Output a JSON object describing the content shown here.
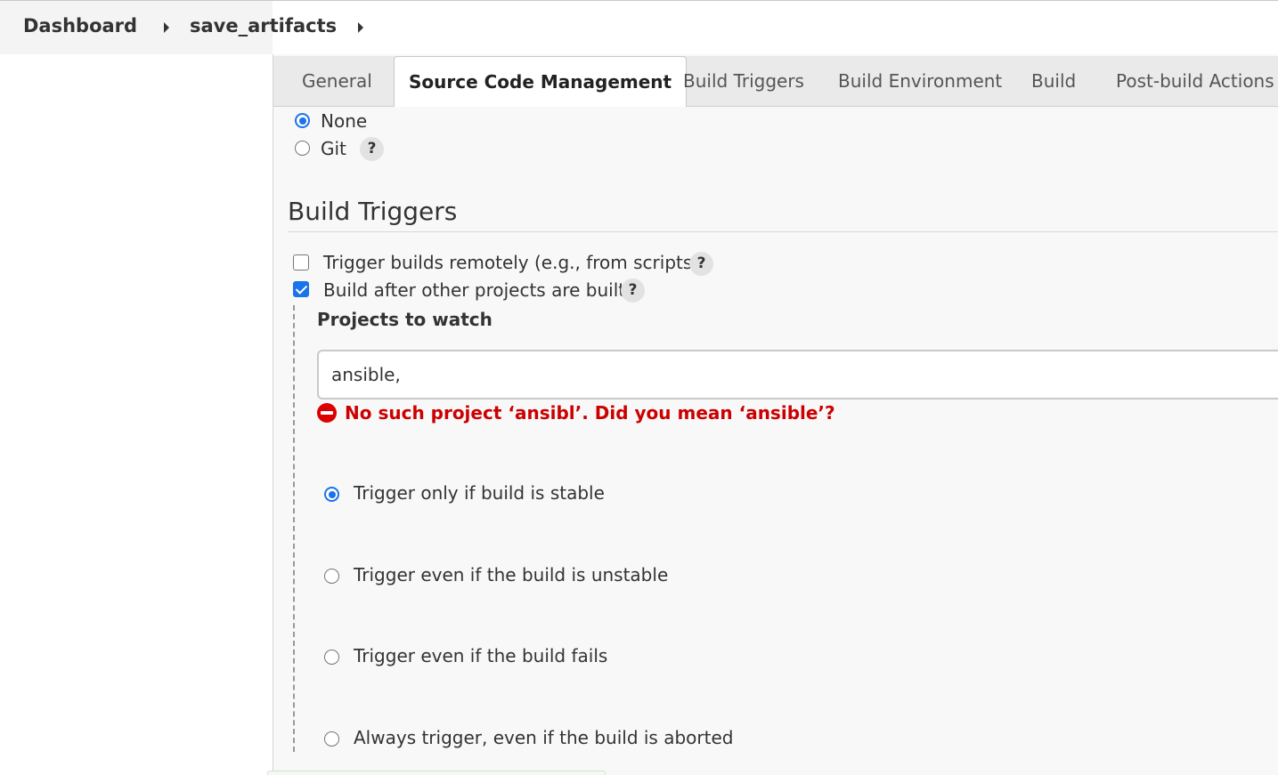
{
  "breadcrumb": {
    "items": [
      "Dashboard",
      "save_artifacts"
    ]
  },
  "tabs": [
    "General",
    "Source Code Management",
    "Build Triggers",
    "Build Environment",
    "Build",
    "Post-build Actions"
  ],
  "active_tab": "Source Code Management",
  "scm": {
    "options": [
      {
        "label": "None",
        "checked": true
      },
      {
        "label": "Git",
        "checked": false
      }
    ],
    "help": "?"
  },
  "build_triggers": {
    "title": "Build Triggers",
    "options": [
      {
        "label": "Trigger builds remotely (e.g., from scripts)",
        "checked": false
      },
      {
        "label": "Build after other projects are built",
        "checked": true
      }
    ],
    "help": "?",
    "projects_to_watch": {
      "label": "Projects to watch",
      "value": "ansible,",
      "error": "No such project ‘ansibl’. Did you mean ‘ansible’?"
    },
    "trigger_conditions": [
      {
        "label": "Trigger only if build is stable",
        "checked": true
      },
      {
        "label": "Trigger even if the build is unstable",
        "checked": false
      },
      {
        "label": "Trigger even if the build fails",
        "checked": false
      },
      {
        "label": "Always trigger, even if the build is aborted",
        "checked": false
      }
    ]
  },
  "colors": {
    "accent": "#1a73e8",
    "error": "#cc0000"
  }
}
